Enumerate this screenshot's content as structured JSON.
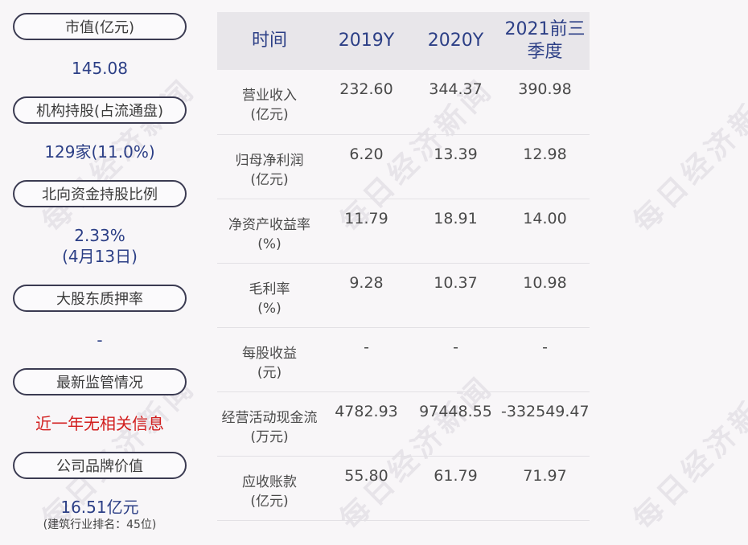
{
  "left_panel": [
    {
      "label": "市值(亿元)",
      "value": "145.08"
    },
    {
      "label": "机构持股(占流通盘)",
      "value": "129家(11.0%)"
    },
    {
      "label": "北向资金持股比例",
      "value_line1": "2.33%",
      "value_line2": "(4月13日)"
    },
    {
      "label": "大股东质押率",
      "value": "-"
    },
    {
      "label": "最新监管情况",
      "value": "近一年无相关信息"
    },
    {
      "label": "公司品牌价值",
      "value": "16.51亿元",
      "note": "(建筑行业排名：45位)"
    }
  ],
  "table": {
    "headers": [
      "时间",
      "2019Y",
      "2020Y",
      "2021前三季度"
    ],
    "rows": [
      {
        "metric_line1": "营业收入",
        "metric_line2": "(亿元)",
        "values": [
          "232.60",
          "344.37",
          "390.98"
        ]
      },
      {
        "metric_line1": "归母净利润",
        "metric_line2": "(亿元)",
        "values": [
          "6.20",
          "13.39",
          "12.98"
        ]
      },
      {
        "metric_line1": "净资产收益率",
        "metric_line2": "(%)",
        "values": [
          "11.79",
          "18.91",
          "14.00"
        ]
      },
      {
        "metric_line1": "毛利率",
        "metric_line2": "(%)",
        "values": [
          "9.28",
          "10.37",
          "10.98"
        ]
      },
      {
        "metric_line1": "每股收益",
        "metric_line2": "(元)",
        "values": [
          "-",
          "-",
          "-"
        ]
      },
      {
        "metric_line1": "经营活动现金流",
        "metric_line2": "(万元)",
        "values": [
          "4782.93",
          "97448.55",
          "-332549.47"
        ]
      },
      {
        "metric_line1": "应收账款",
        "metric_line2": "(亿元)",
        "values": [
          "55.80",
          "61.79",
          "71.97"
        ]
      }
    ]
  },
  "watermark": "每日经济新闻",
  "colors": {
    "value_blue": "#2c3f86",
    "alert_red": "#d21e1e",
    "header_bg": "#e8e6ea"
  }
}
